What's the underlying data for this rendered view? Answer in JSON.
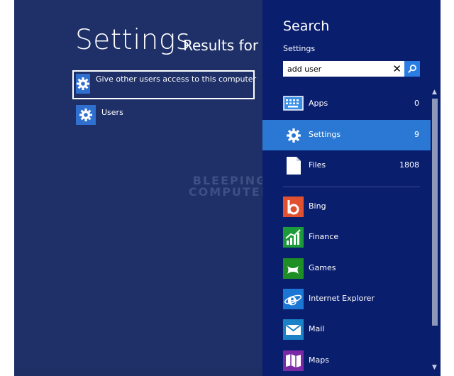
{
  "results": {
    "title": "Settings",
    "results_for": "Results for “ad",
    "items": [
      {
        "label": "Give other users access to this computer",
        "icon": "gear-icon"
      },
      {
        "label": "Users",
        "icon": "gear-icon"
      }
    ]
  },
  "watermark": [
    "BLEEPING",
    "COMPUTER"
  ],
  "search": {
    "title": "Search",
    "scope": "Settings",
    "query": "add user",
    "categories": [
      {
        "label": "Apps",
        "count": "0",
        "icon": "apps-icon"
      },
      {
        "label": "Settings",
        "count": "9",
        "icon": "gear-icon"
      },
      {
        "label": "Files",
        "count": "1808",
        "icon": "file-icon"
      }
    ],
    "apps": [
      {
        "label": "Bing",
        "color": "#e2512f",
        "icon": "bing-icon"
      },
      {
        "label": "Finance",
        "color": "#1c9b3a",
        "icon": "finance-icon"
      },
      {
        "label": "Games",
        "color": "#1e8f24",
        "icon": "games-icon"
      },
      {
        "label": "Internet Explorer",
        "color": "#1b76d4",
        "icon": "internet-explorer-icon"
      },
      {
        "label": "Mail",
        "color": "#1b82c7",
        "icon": "mail-icon"
      },
      {
        "label": "Maps",
        "color": "#7b2aa6",
        "icon": "maps-icon"
      }
    ]
  },
  "colors": {
    "results_bg": "#1f3068",
    "pane_bg": "#0a1e6e",
    "accent": "#2a78d3"
  }
}
